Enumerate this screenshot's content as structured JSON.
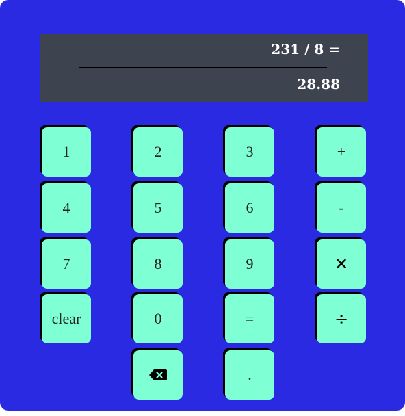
{
  "display": {
    "expression": "231 / 8 =",
    "result": "28.88"
  },
  "keys": {
    "one": "1",
    "two": "2",
    "three": "3",
    "plus": "+",
    "four": "4",
    "five": "5",
    "six": "6",
    "minus": "-",
    "seven": "7",
    "eight": "8",
    "nine": "9",
    "multiply": "✕",
    "clear": "clear",
    "zero": "0",
    "equals": "=",
    "divide": "÷",
    "backspace_icon": "backspace-icon",
    "decimal": "."
  },
  "colors": {
    "background": "#2a2ae2",
    "display": "#3d4450",
    "key": "#7fffd4"
  }
}
